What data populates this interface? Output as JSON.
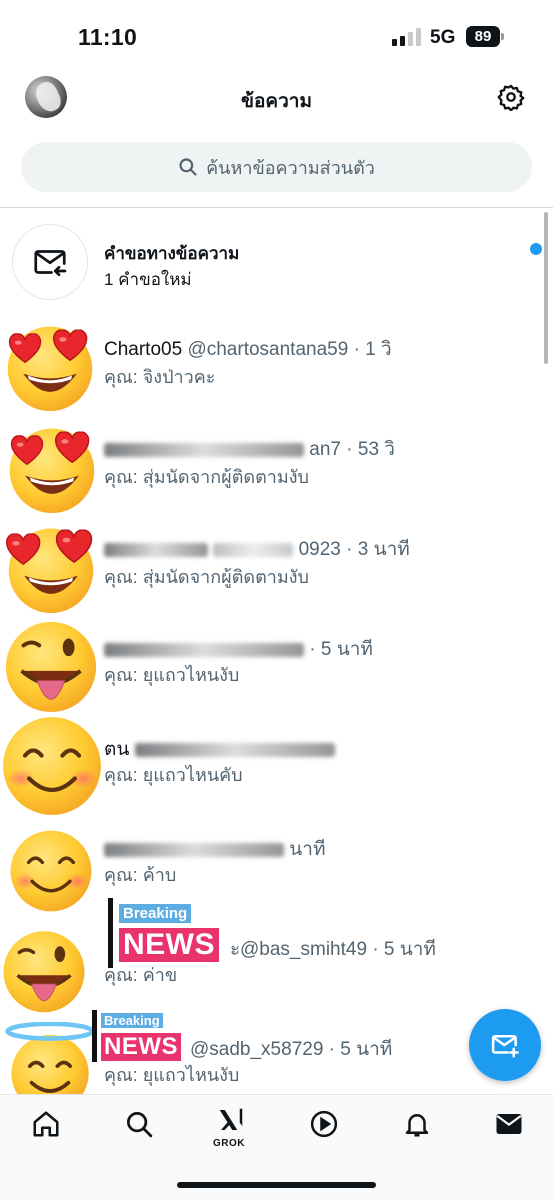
{
  "status_bar": {
    "time": "11:10",
    "network": "5G",
    "battery": "89"
  },
  "header": {
    "title": "ข้อความ"
  },
  "search": {
    "placeholder": "ค้นหาข้อความส่วนตัว"
  },
  "requests": {
    "title": "คำขอทางข้อความ",
    "subtitle": "1 คำขอใหม่"
  },
  "conversations": [
    {
      "name": "Charto05",
      "handle": "@chartosantana59",
      "time": "· 1 วิ",
      "preview": "คุณ: จิงป่าวคะ",
      "avatar": "heart-eyes-emoji"
    },
    {
      "name": "",
      "handle": "an7",
      "time": "· 53 วิ",
      "preview": "คุณ: สุ่มนัดจากผู้ติดตามงับ",
      "avatar": "heart-eyes-emoji"
    },
    {
      "name": "",
      "handle": "0923",
      "time": "· 3 นาที",
      "preview": "คุณ: สุ่มนัดจากผู้ติดตามงับ",
      "avatar": "heart-eyes-emoji"
    },
    {
      "name": "",
      "handle": "",
      "time": "· 5 นาที",
      "preview": "คุณ: ยุแถวไหนงับ",
      "avatar": "winking-tongue-emoji"
    },
    {
      "name": "ตน",
      "handle": "",
      "time": "",
      "preview": "คุณ: ยุแถวไหนคับ",
      "avatar": "smiling-blush-emoji"
    },
    {
      "name": "",
      "handle": "",
      "time": "นาที",
      "preview": "คุณ: ค้าบ",
      "avatar": "smiling-blush-emoji"
    },
    {
      "name": "",
      "handle": "@bas_smiht49",
      "time": "· 5 นาที",
      "preview": "คุณ: ค่าข",
      "avatar": "winking-tongue-emoji"
    },
    {
      "name": "",
      "handle": "@sadb_x58729",
      "time": "· 5 นาที",
      "preview": "คุณ: ยุแถวไหนงับ",
      "avatar": "halo-smile-emoji"
    }
  ],
  "stickers": [
    {
      "top": "Breaking",
      "bottom": "NEWS",
      "trailing": "ะ"
    },
    {
      "top": "Breaking",
      "bottom": "NEWS"
    }
  ],
  "bottom_nav": {
    "grok_label": "GROK"
  },
  "colors": {
    "accent": "#1d9bf0",
    "text": "#0f1419",
    "secondary": "#536471",
    "search_bg": "#eff3f4",
    "news_pink": "#e8336d",
    "news_blue": "#5dade2"
  }
}
